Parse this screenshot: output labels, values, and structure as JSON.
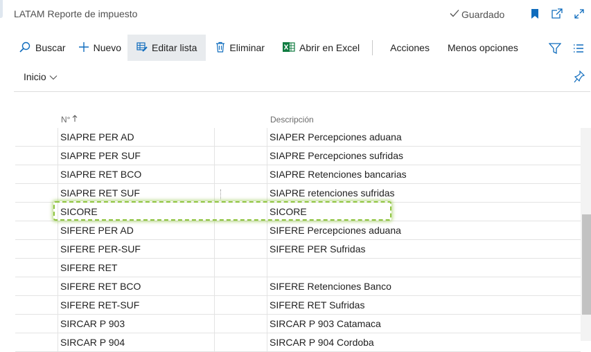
{
  "header": {
    "title": "LATAM Reporte de impuesto",
    "saved_label": "Guardado"
  },
  "toolbar": {
    "search_label": "Buscar",
    "new_label": "Nuevo",
    "edit_list_label": "Editar lista",
    "delete_label": "Eliminar",
    "open_excel_label": "Abrir en Excel",
    "actions_label": "Acciones",
    "less_options_label": "Menos opciones"
  },
  "subnav": {
    "home_label": "Inicio"
  },
  "columns": {
    "no": "N°",
    "description": "Descripción"
  },
  "rows": [
    {
      "no": "SIAPRE PER AD",
      "description": "SIAPER Percepciones aduana"
    },
    {
      "no": "SIAPRE PER SUF",
      "description": "SIAPRE Percepciones sufridas"
    },
    {
      "no": "SIAPRE RET BCO",
      "description": "SIAPRE Retenciones bancarias"
    },
    {
      "no": "SIAPRE RET SUF",
      "description": "SIAPRE retenciones sufridas"
    },
    {
      "no": "SICORE",
      "description": "SICORE"
    },
    {
      "no": "SIFERE PER AD",
      "description": "SIFERE Percepciones aduana"
    },
    {
      "no": "SIFERE PER-SUF",
      "description": "SIFERE PER Sufridas"
    },
    {
      "no": "SIFERE RET",
      "description": ""
    },
    {
      "no": "SIFERE RET BCO",
      "description": "SIFERE Retenciones Banco"
    },
    {
      "no": "SIFERE RET-SUF",
      "description": "SIFERE RET Sufridas"
    },
    {
      "no": "SIRCAR P 903",
      "description": "SIRCAR P 903 Catamaca"
    },
    {
      "no": "SIRCAR P 904",
      "description": "SIRCAR P 904 Cordoba"
    }
  ],
  "colors": {
    "accent": "#0f6cbd",
    "excel_green": "#107c41",
    "highlight": "#8fc440"
  }
}
